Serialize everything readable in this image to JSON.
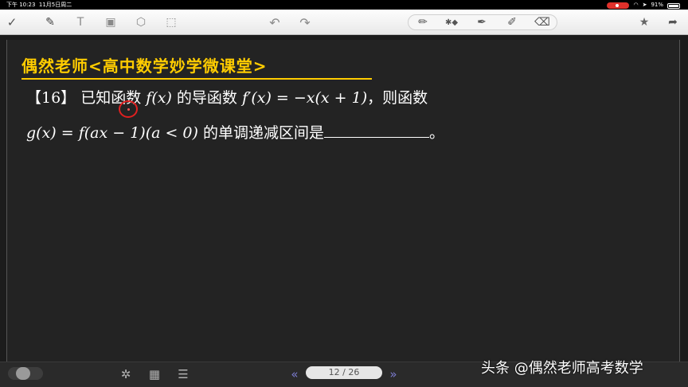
{
  "status_bar": {
    "time": "下午 10:23",
    "date": "11月5日周二",
    "battery": "91%"
  },
  "toolbar": {
    "icons": [
      "check-circle-icon",
      "pen-icon",
      "text-icon",
      "image-icon",
      "shape-icon",
      "select-icon",
      "undo-icon",
      "redo-icon",
      "pencil-icon",
      "bluetooth-icon",
      "marker-icon",
      "highlighter-icon",
      "eraser-icon",
      "star-icon",
      "share-icon"
    ],
    "text_tool_label": "T"
  },
  "board": {
    "banner": "偶然老师<高中数学妙学微课堂>",
    "problem_number": "【16】",
    "line1_text_a": "已知函数",
    "line1_math_a": "f(x)",
    "line1_text_b": "的导函数",
    "line1_math_b": "f′(x) = −x(x + 1)",
    "line1_text_c": "，则函数",
    "line2_math": "g(x) = f(ax − 1)(a < 0)",
    "line2_text": "的单调递减区间是",
    "line2_end": "。"
  },
  "bottom_bar": {
    "page_indicator": "12 / 26",
    "icons": [
      "toggle-icon",
      "settings-icon",
      "grid-icon",
      "menu-icon",
      "prev-page-icon",
      "next-page-icon"
    ]
  },
  "watermark": "头条 @偶然老师高考数学"
}
